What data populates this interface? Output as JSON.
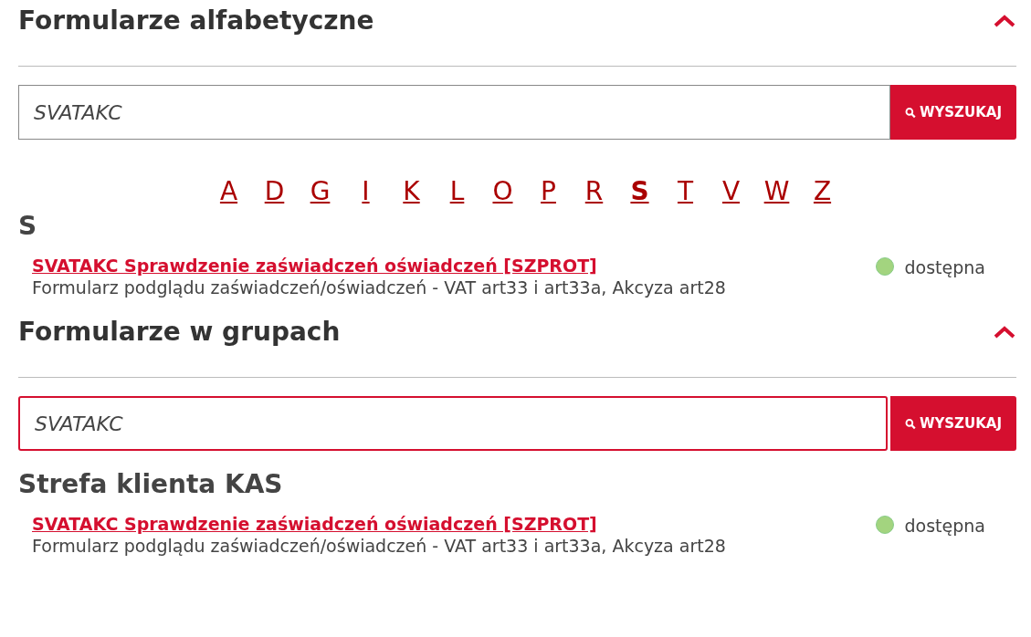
{
  "sections": [
    {
      "title": "Formularze alfabetyczne",
      "expanded": true,
      "search": {
        "value": "SVATAKC",
        "focused": false,
        "button": "WYSZUKAJ"
      },
      "letters": [
        {
          "label": "A",
          "selected": false
        },
        {
          "label": "D",
          "selected": false
        },
        {
          "label": "G",
          "selected": false
        },
        {
          "label": "I",
          "selected": false
        },
        {
          "label": "K",
          "selected": false
        },
        {
          "label": "L",
          "selected": false
        },
        {
          "label": "O",
          "selected": false
        },
        {
          "label": "P",
          "selected": false
        },
        {
          "label": "R",
          "selected": false
        },
        {
          "label": "S",
          "selected": true
        },
        {
          "label": "T",
          "selected": false
        },
        {
          "label": "V",
          "selected": false
        },
        {
          "label": "W",
          "selected": false
        },
        {
          "label": "Z",
          "selected": false
        }
      ],
      "group_heading": "S",
      "results": [
        {
          "title": "SVATAKC Sprawdzenie zaświadczeń oświadczeń [SZPROT]",
          "description": "Formularz podglądu zaświadczeń/oświadczeń - VAT art33 i art33a, Akcyza art28",
          "status": "dostępna",
          "color": "#a3d47f"
        }
      ]
    },
    {
      "title": "Formularze w grupach",
      "expanded": true,
      "search": {
        "value": "SVATAKC",
        "focused": true,
        "button": "WYSZUKAJ"
      },
      "group_heading": "Strefa klienta KAS",
      "results": [
        {
          "title": "SVATAKC Sprawdzenie zaświadczeń oświadczeń [SZPROT]",
          "description": "Formularz podglądu zaświadczeń/oświadczeń - VAT art33 i art33a, Akcyza art28",
          "status": "dostępna",
          "color": "#a3d47f"
        }
      ]
    }
  ]
}
